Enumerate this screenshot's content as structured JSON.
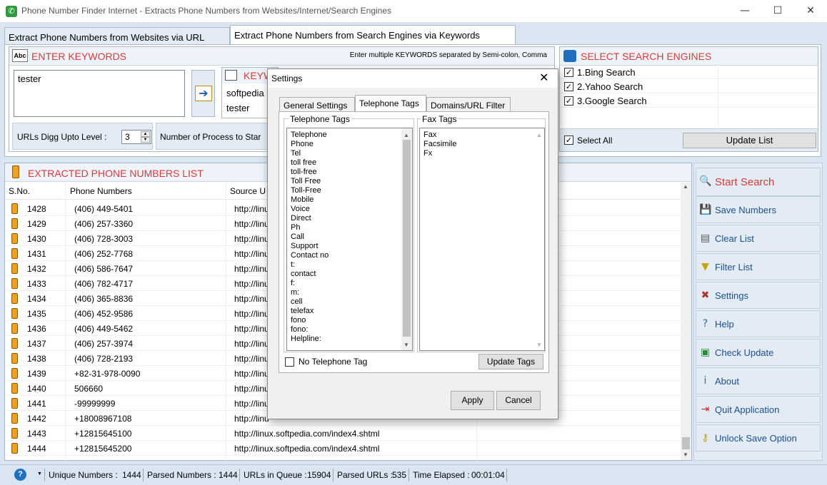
{
  "window": {
    "title": "Phone Number Finder Internet - Extracts Phone Numbers from Websites/Internet/Search Engines",
    "minimize": "—",
    "maximize": "☐",
    "close": "✕"
  },
  "tabs": [
    {
      "label": "Extract Phone Numbers from Websites via URL"
    },
    {
      "label": "Extract Phone Numbers from Search Engines via Keywords"
    }
  ],
  "keywords": {
    "heading": "ENTER KEYWORDS",
    "hint": "Enter multiple KEYWORDS separated by Semi-colon, Comma",
    "input_value": "tester",
    "added_heading": "KEYW",
    "added_items": [
      "softpedia",
      "tester"
    ],
    "urls_digg_label": "URLs Digg Upto Level :",
    "urls_digg_value": "3",
    "num_process_label": "Number of Process to Star"
  },
  "engines": {
    "heading": "SELECT SEARCH ENGINES",
    "items": [
      {
        "label": "1.Bing Search",
        "checked": true
      },
      {
        "label": "2.Yahoo Search",
        "checked": true
      },
      {
        "label": "3.Google Search",
        "checked": true
      }
    ],
    "select_all_label": "Select All",
    "update_list_label": "Update List"
  },
  "list": {
    "heading": "EXTRACTED PHONE NUMBERS LIST",
    "columns": [
      "S.No.",
      "Phone Numbers",
      "Source U"
    ],
    "rows": [
      {
        "sno": "1428",
        "phone": "(406) 449-5401",
        "source": "http://linu"
      },
      {
        "sno": "1429",
        "phone": "(406) 257-3360",
        "source": "http://linu"
      },
      {
        "sno": "1430",
        "phone": "(406) 728-3003",
        "source": "http://linu"
      },
      {
        "sno": "1431",
        "phone": "(406) 252-7768",
        "source": "http://linu"
      },
      {
        "sno": "1432",
        "phone": "(406) 586-7647",
        "source": "http://linu"
      },
      {
        "sno": "1433",
        "phone": "(406) 782-4717",
        "source": "http://linu"
      },
      {
        "sno": "1434",
        "phone": "(406) 365-8836",
        "source": "http://linu"
      },
      {
        "sno": "1435",
        "phone": "(406) 452-9586",
        "source": "http://linu"
      },
      {
        "sno": "1436",
        "phone": "(406) 449-5462",
        "source": "http://linu"
      },
      {
        "sno": "1437",
        "phone": "(406) 257-3974",
        "source": "http://linu"
      },
      {
        "sno": "1438",
        "phone": "(406) 728-2193",
        "source": "http://linu"
      },
      {
        "sno": "1439",
        "phone": "+82-31-978-0090",
        "source": "http://linu"
      },
      {
        "sno": "1440",
        "phone": "506660",
        "source": "http://linu"
      },
      {
        "sno": "1441",
        "phone": "-99999999",
        "source": "http://linu"
      },
      {
        "sno": "1442",
        "phone": "+18008967108",
        "source": "http://linu"
      },
      {
        "sno": "1443",
        "phone": "+12815645100",
        "source": "http://linux.softpedia.com/index4.shtml"
      },
      {
        "sno": "1444",
        "phone": "+12815645200",
        "source": "http://linux.softpedia.com/index4.shtml"
      }
    ]
  },
  "sidebar": {
    "items": [
      {
        "label": "Start Search",
        "icon": "search-icon",
        "glyph": "🔍"
      },
      {
        "label": "Save Numbers",
        "icon": "save-icon",
        "glyph": "💾"
      },
      {
        "label": "Clear List",
        "icon": "clear-icon",
        "glyph": "▤"
      },
      {
        "label": "Filter List",
        "icon": "filter-icon",
        "glyph": "▼"
      },
      {
        "label": "Settings",
        "icon": "settings-icon",
        "glyph": "✖"
      },
      {
        "label": "Help",
        "icon": "help-icon",
        "glyph": "?"
      },
      {
        "label": "Check Update",
        "icon": "update-icon",
        "glyph": "▣"
      },
      {
        "label": "About",
        "icon": "about-icon",
        "glyph": "i"
      },
      {
        "label": "Quit Application",
        "icon": "quit-icon",
        "glyph": "⇥"
      },
      {
        "label": "Unlock Save Option",
        "icon": "key-icon",
        "glyph": "⚷"
      }
    ]
  },
  "status": {
    "unique_label": "Unique Numbers :",
    "unique_value": "1444",
    "parsed_label": "Parsed Numbers :",
    "parsed_value": "1444",
    "queue_label": "URLs in Queue :",
    "queue_value": "15904",
    "parsed_urls_label": "Parsed URLs :",
    "parsed_urls_value": "535",
    "elapsed_label": "Time Elapsed :",
    "elapsed_value": "00:01:04"
  },
  "dialog": {
    "title": "Settings",
    "tabs": [
      "General Settings",
      "Telephone Tags",
      "Domains/URL Filter"
    ],
    "telephone_tags_label": "Telephone Tags",
    "telephone_tags": [
      "Telephone",
      "Phone",
      "Tel",
      "toll free",
      "toll-free",
      "Toll Free",
      "Toll-Free",
      "Mobile",
      "Voice",
      "Direct",
      "Ph",
      "Call",
      "Support",
      "Contact no",
      "t:",
      "contact",
      "f:",
      "m:",
      "cell",
      "telefax",
      "fono",
      "fono:",
      "Helpline:"
    ],
    "fax_tags_label": "Fax Tags",
    "fax_tags": [
      "Fax",
      "Facsimile",
      "Fx"
    ],
    "no_tel_tag_label": "No Telephone Tag",
    "update_tags_label": "Update Tags",
    "apply_label": "Apply",
    "cancel_label": "Cancel"
  }
}
